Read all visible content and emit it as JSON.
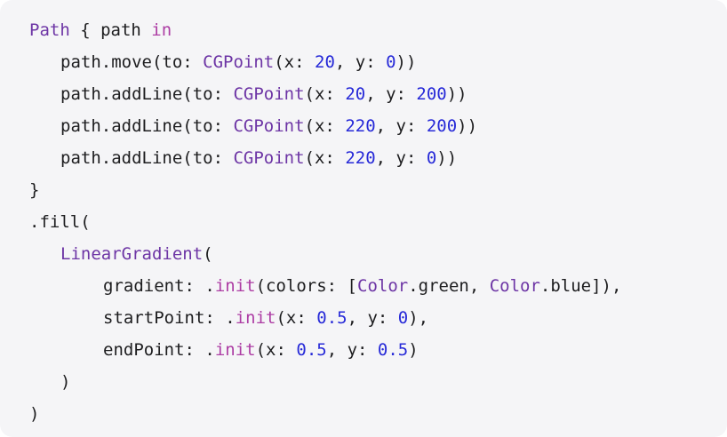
{
  "colors": {
    "background": "#f5f5f7",
    "text": "#1d1d1f",
    "type": "#6d35a5",
    "keyword": "#ad3da4",
    "number": "#272ad8"
  },
  "code": {
    "lines": [
      {
        "indent": 0,
        "tokens": [
          {
            "t": "Path",
            "k": "type"
          },
          {
            "t": " { path ",
            "k": "default"
          },
          {
            "t": "in",
            "k": "keyword"
          }
        ]
      },
      {
        "indent": 1,
        "tokens": [
          {
            "t": "path.move(to: ",
            "k": "default"
          },
          {
            "t": "CGPoint",
            "k": "type"
          },
          {
            "t": "(x: ",
            "k": "default"
          },
          {
            "t": "20",
            "k": "number"
          },
          {
            "t": ", y: ",
            "k": "default"
          },
          {
            "t": "0",
            "k": "number"
          },
          {
            "t": "))",
            "k": "default"
          }
        ]
      },
      {
        "indent": 1,
        "tokens": [
          {
            "t": "path.addLine(to: ",
            "k": "default"
          },
          {
            "t": "CGPoint",
            "k": "type"
          },
          {
            "t": "(x: ",
            "k": "default"
          },
          {
            "t": "20",
            "k": "number"
          },
          {
            "t": ", y: ",
            "k": "default"
          },
          {
            "t": "200",
            "k": "number"
          },
          {
            "t": "))",
            "k": "default"
          }
        ]
      },
      {
        "indent": 1,
        "tokens": [
          {
            "t": "path.addLine(to: ",
            "k": "default"
          },
          {
            "t": "CGPoint",
            "k": "type"
          },
          {
            "t": "(x: ",
            "k": "default"
          },
          {
            "t": "220",
            "k": "number"
          },
          {
            "t": ", y: ",
            "k": "default"
          },
          {
            "t": "200",
            "k": "number"
          },
          {
            "t": "))",
            "k": "default"
          }
        ]
      },
      {
        "indent": 1,
        "tokens": [
          {
            "t": "path.addLine(to: ",
            "k": "default"
          },
          {
            "t": "CGPoint",
            "k": "type"
          },
          {
            "t": "(x: ",
            "k": "default"
          },
          {
            "t": "220",
            "k": "number"
          },
          {
            "t": ", y: ",
            "k": "default"
          },
          {
            "t": "0",
            "k": "number"
          },
          {
            "t": "))",
            "k": "default"
          }
        ]
      },
      {
        "indent": 0,
        "tokens": [
          {
            "t": "}",
            "k": "default"
          }
        ]
      },
      {
        "indent": 0,
        "tokens": [
          {
            "t": ".fill(",
            "k": "default"
          }
        ]
      },
      {
        "indent": 1,
        "tokens": [
          {
            "t": "LinearGradient",
            "k": "type"
          },
          {
            "t": "(",
            "k": "default"
          }
        ]
      },
      {
        "indent": 2,
        "tokens": [
          {
            "t": "gradient: .",
            "k": "default"
          },
          {
            "t": "init",
            "k": "keyword"
          },
          {
            "t": "(colors: [",
            "k": "default"
          },
          {
            "t": "Color",
            "k": "type"
          },
          {
            "t": ".green, ",
            "k": "default"
          },
          {
            "t": "Color",
            "k": "type"
          },
          {
            "t": ".blue]),",
            "k": "default"
          }
        ]
      },
      {
        "indent": 2,
        "tokens": [
          {
            "t": "startPoint: .",
            "k": "default"
          },
          {
            "t": "init",
            "k": "keyword"
          },
          {
            "t": "(x: ",
            "k": "default"
          },
          {
            "t": "0.5",
            "k": "number"
          },
          {
            "t": ", y: ",
            "k": "default"
          },
          {
            "t": "0",
            "k": "number"
          },
          {
            "t": "),",
            "k": "default"
          }
        ]
      },
      {
        "indent": 2,
        "tokens": [
          {
            "t": "endPoint: .",
            "k": "default"
          },
          {
            "t": "init",
            "k": "keyword"
          },
          {
            "t": "(x: ",
            "k": "default"
          },
          {
            "t": "0.5",
            "k": "number"
          },
          {
            "t": ", y: ",
            "k": "default"
          },
          {
            "t": "0.5",
            "k": "number"
          },
          {
            "t": ")",
            "k": "default"
          }
        ]
      },
      {
        "indent": 1,
        "tokens": [
          {
            "t": ")",
            "k": "default"
          }
        ]
      },
      {
        "indent": 0,
        "tokens": [
          {
            "t": ")",
            "k": "default"
          }
        ]
      }
    ]
  }
}
